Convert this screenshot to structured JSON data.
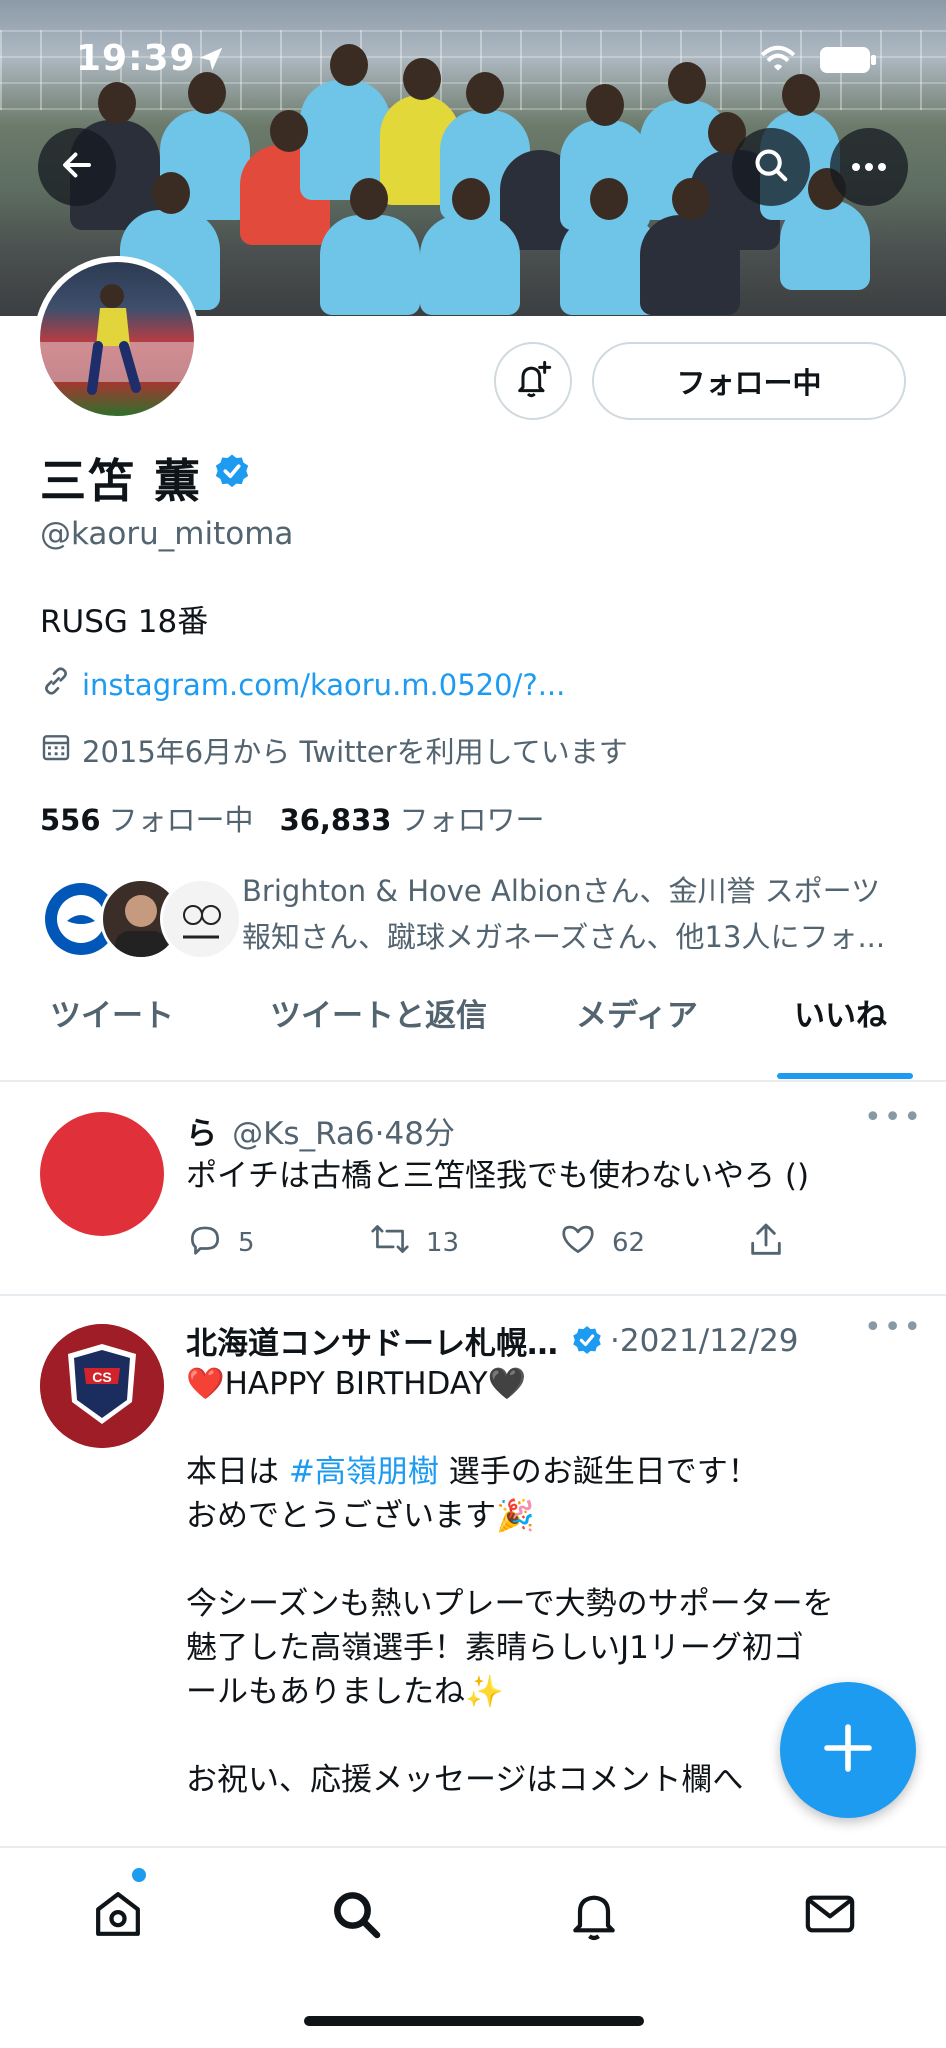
{
  "status_bar": {
    "time": "19:39"
  },
  "profile": {
    "display_name": "三笘 薫",
    "handle": "@kaoru_mitoma",
    "bio": "RUSG 18番",
    "link": "instagram.com/kaoru.m.0520/?...",
    "joined": "2015年6月から Twitterを利用しています",
    "following_count": "556",
    "following_label": "フォロー中",
    "followers_count": "36,833",
    "followers_label": "フォロワー",
    "followed_by_line1": "Brighton & Hove Albionさん、金川誉 スポーツ",
    "followed_by_line2": "報知さん、蹴球メガネーズさん、他13人にフォ..."
  },
  "follow_button": {
    "label": "フォロー中"
  },
  "tabs": [
    {
      "label": "ツイート"
    },
    {
      "label": "ツイートと返信"
    },
    {
      "label": "メディア"
    },
    {
      "label": "いいね"
    }
  ],
  "tweets": [
    {
      "name": "ら",
      "handle": "@Ks_Ra6",
      "time": "48分",
      "text": "ポイチは古橋と三笘怪我でも使わないやろ ()",
      "replies": "5",
      "retweets": "13",
      "likes": "62"
    },
    {
      "name": "北海道コンサドーレ札幌…",
      "time": "2021/12/29",
      "line1": "❤️HAPPY BIRTHDAY🖤",
      "line2_pre": "本日は ",
      "line2_tag": "#高嶺朋樹",
      "line2_post": " 選手のお誕生日です！",
      "line3": "おめでとうございます🎉",
      "line4": "今シーズンも熱いプレーで大勢のサポーターを",
      "line5": "魅了した高嶺選手！素晴らしいJ1リーグ初ゴ",
      "line6": "ールもありましたね✨",
      "line7": "お祝い、応援メッセージはコメント欄へ"
    }
  ],
  "colors": {
    "accent": "#1d9bf0",
    "text": "#0f1419",
    "muted": "#536471"
  },
  "icons": [
    "back-arrow-icon",
    "search-icon",
    "more-icon",
    "bell-plus-icon",
    "verified-icon",
    "link-icon",
    "calendar-icon",
    "reply-icon",
    "retweet-icon",
    "like-icon",
    "share-icon",
    "compose-icon",
    "home-icon",
    "explore-icon",
    "notifications-icon",
    "messages-icon"
  ]
}
